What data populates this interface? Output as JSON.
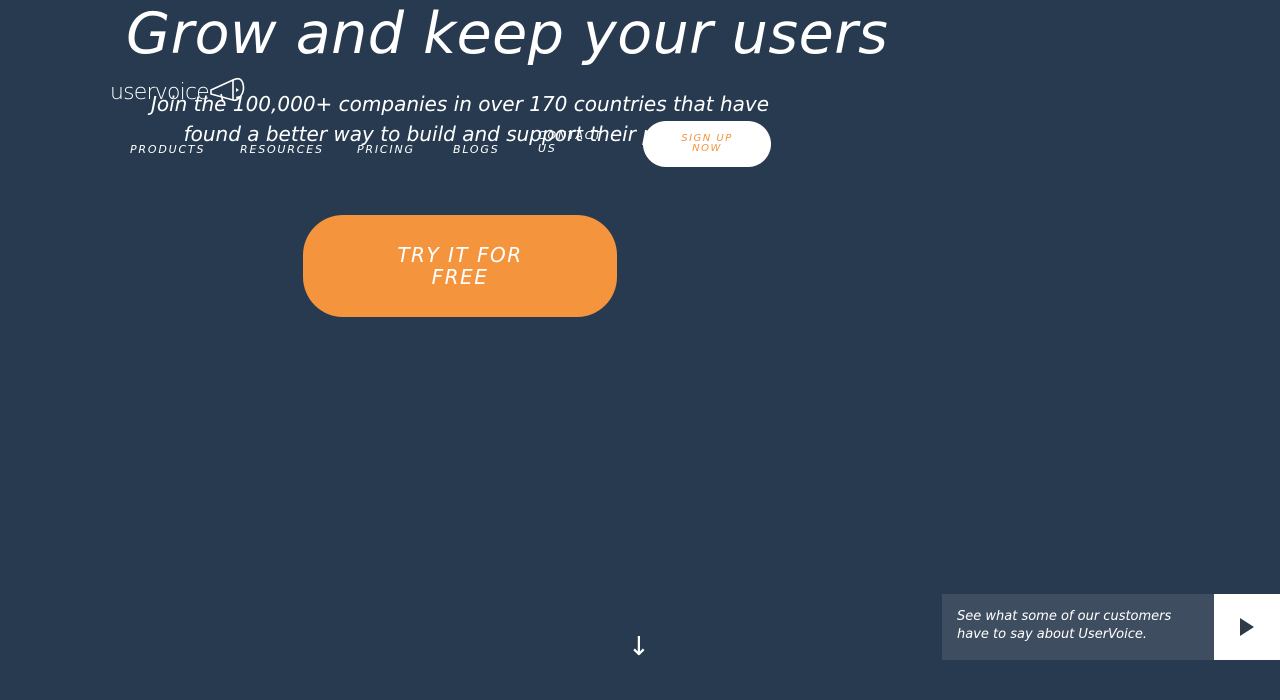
{
  "hero": {
    "title": "Grow and keep your users",
    "subtitle": "Join the 100,000+ companies in over 170 countries that have found a better way to build and support their products."
  },
  "header": {
    "logo_text": "uservoice",
    "nav": {
      "products": "Products",
      "resources": "Resources",
      "pricing": "Pricing",
      "blogs": "Blogs",
      "contact": "Contact Us"
    },
    "signup_label": "Sign Up Now"
  },
  "cta": {
    "label": "Try it for free"
  },
  "scroll": {
    "icon": "arrow-down-icon",
    "glyph": "↓"
  },
  "video": {
    "text": "See what some of our customers have to say about UserVoice.",
    "icon": "play-icon"
  },
  "colors": {
    "background": "#283a4f",
    "accent": "#f4943d",
    "video_panel": "#3e4e60"
  }
}
